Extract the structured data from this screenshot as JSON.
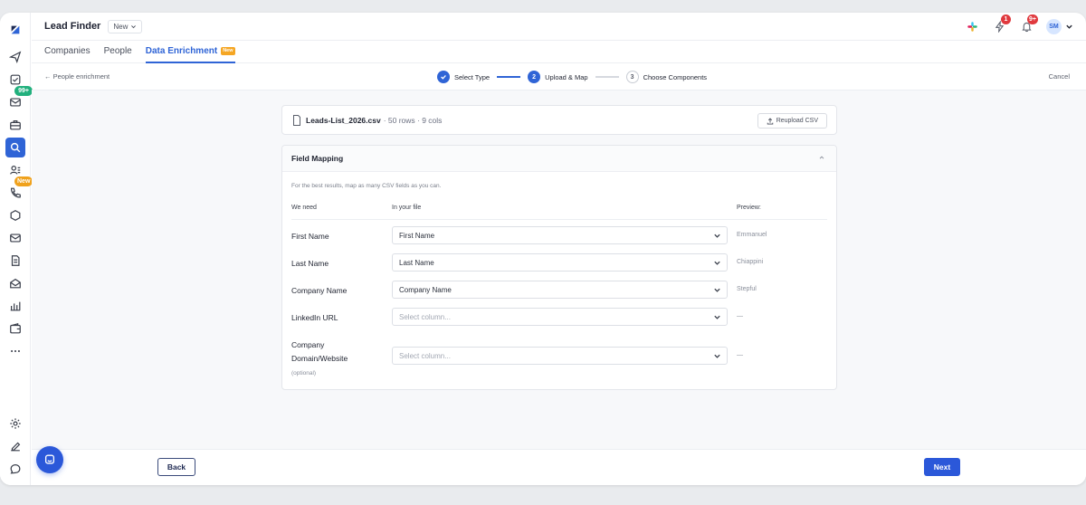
{
  "header": {
    "app_title": "Lead Finder",
    "view_select": "New",
    "notifications_badge": "1",
    "alerts_badge": "9+",
    "avatar_initials": "SM"
  },
  "sidebar": {
    "inbox_badge": "99+",
    "calls_badge": "New"
  },
  "tabs": [
    {
      "label": "Companies"
    },
    {
      "label": "People"
    },
    {
      "label": "Data Enrichment",
      "tag": "New"
    }
  ],
  "stepbar": {
    "back_label": "← People enrichment",
    "cancel_label": "Cancel",
    "steps": [
      {
        "number": "1",
        "label": "Select Type",
        "state": "done"
      },
      {
        "number": "2",
        "label": "Upload & Map",
        "state": "current"
      },
      {
        "number": "3",
        "label": "Choose Components",
        "state": "todo"
      }
    ]
  },
  "file": {
    "name": "Leads-List_2026.csv",
    "meta": "· 50 rows · 9 cols",
    "reupload_label": "Reupload CSV"
  },
  "mapping": {
    "title": "Field Mapping",
    "hint": "For the best results, map as many CSV fields as you can.",
    "col_need": "We need",
    "col_file": "In your file",
    "col_preview": "Preview:",
    "rows": [
      {
        "label": "First Name",
        "value": "First Name",
        "preview": "Emmanuel"
      },
      {
        "label": "Last Name",
        "value": "Last Name",
        "preview": "Chiappini"
      },
      {
        "label": "Company Name",
        "value": "Company Name",
        "preview": "Stepful"
      },
      {
        "label": "LinkedIn URL",
        "placeholder": "Select column...",
        "preview": "—"
      },
      {
        "label": "Company Domain/Website",
        "optional": "(optional)",
        "placeholder": "Select column...",
        "preview": "—"
      }
    ]
  },
  "footer": {
    "back_label": "Back",
    "next_label": "Next"
  },
  "colors": {
    "primary": "#2b58d9",
    "accent_new": "#f5a623",
    "badge_red": "#e0393e",
    "badge_green": "#22b07d"
  }
}
